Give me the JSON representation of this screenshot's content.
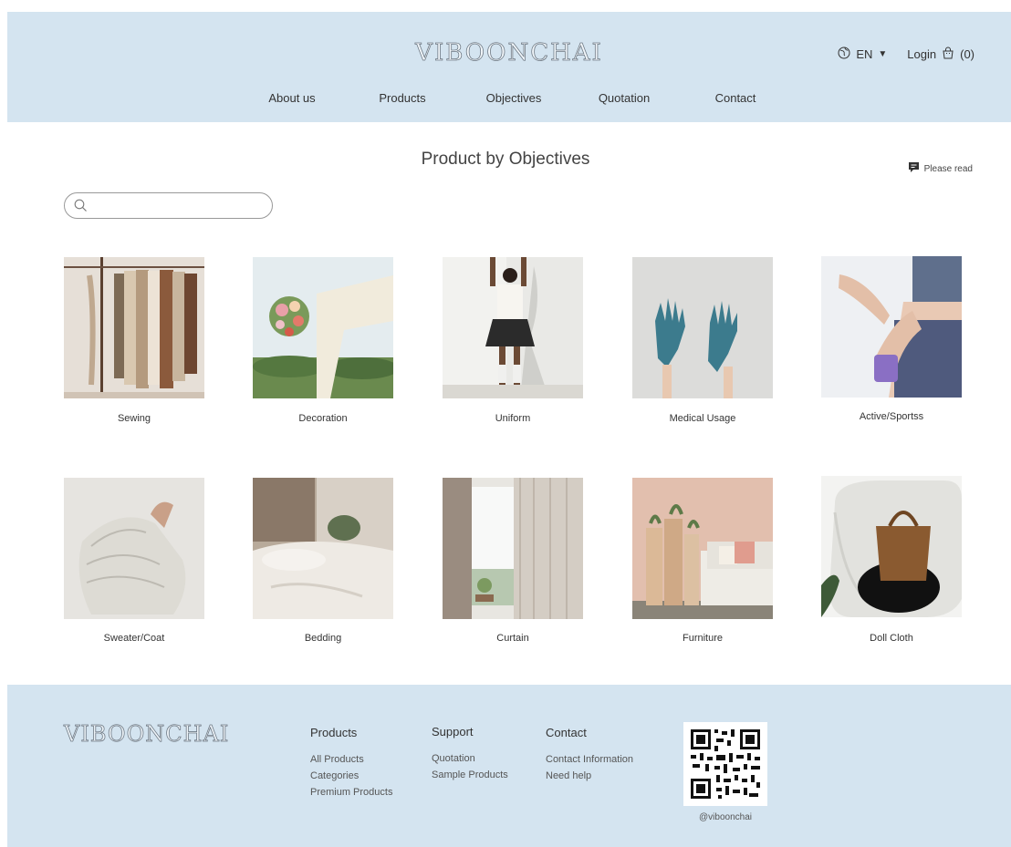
{
  "header": {
    "brand": "VIBOONCHAI",
    "language": "EN",
    "login": "Login",
    "cart_count": "(0)",
    "nav": [
      "About us",
      "Products",
      "Objectives",
      "Quotation",
      "Contact"
    ]
  },
  "main": {
    "title": "Product  by Objectives",
    "please_read": "Please read",
    "search": {
      "value": "",
      "placeholder": ""
    },
    "categories": [
      "Sewing",
      "Decoration",
      "Uniform",
      "Medical Usage",
      "Active/Sportss",
      "Sweater/Coat",
      "Bedding",
      "Curtain",
      "Furniture",
      "Doll Cloth"
    ]
  },
  "footer": {
    "brand": "VIBOONCHAI",
    "products": {
      "heading": "Products",
      "links": [
        "All Products",
        "Categories",
        "Premium Products"
      ]
    },
    "support": {
      "heading": "Support",
      "links": [
        "Quotation",
        "Sample Products"
      ]
    },
    "contact": {
      "heading": "Contact",
      "links": [
        "Contact Information",
        "Need help"
      ]
    },
    "social_handle": "@viboonchai"
  },
  "colors": {
    "band": "#d4e4f0",
    "text": "#333333"
  }
}
